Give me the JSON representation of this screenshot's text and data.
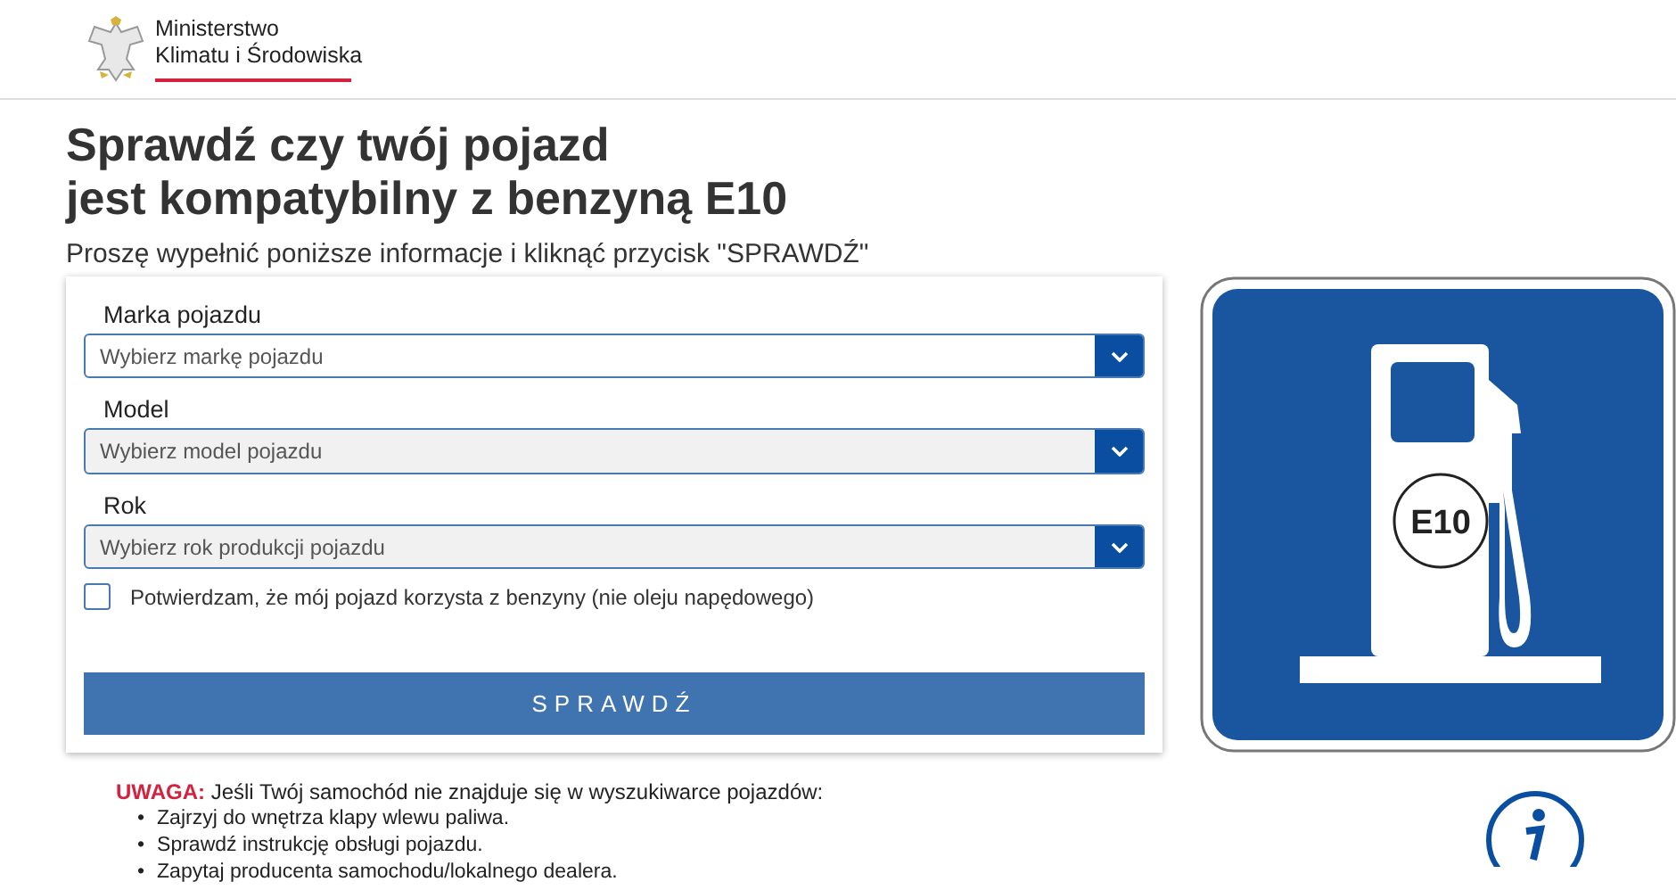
{
  "header": {
    "logo_line_1": "Ministerstwo",
    "logo_line_2": "Klimatu i Środowiska"
  },
  "title_line_1": "Sprawdź czy twój pojazd",
  "title_line_2": "jest kompatybilny z benzyną E10",
  "subtitle": "Proszę wypełnić poniższe informacje i kliknąć przycisk \"SPRAWDŹ\"",
  "form": {
    "fields": [
      {
        "label": "Marka pojazdu",
        "placeholder": "Wybierz markę pojazdu",
        "disabled": false
      },
      {
        "label": "Model",
        "placeholder": "Wybierz model pojazdu",
        "disabled": true
      },
      {
        "label": "Rok",
        "placeholder": "Wybierz rok produkcji pojazdu",
        "disabled": true
      }
    ],
    "confirm": {
      "label": "Potwierdzam, że mój pojazd korzysta z benzyny (nie oleju napędowego)",
      "checked": false
    },
    "submit": "SPRAWDŹ"
  },
  "sign": {
    "label": "E10"
  },
  "notice": {
    "bullet": "•",
    "warning": "UWAGA:",
    "text": "Jeśli Twój samochód nie znajduje się w wyszukiwarce pojazdów:",
    "items": [
      "Zajrzyj do wnętrza klapy wlewu paliwa.",
      "Sprawdź instrukcję obsługi pojazdu.",
      "Zapytaj producenta samochodu/lokalnego dealera."
    ]
  }
}
